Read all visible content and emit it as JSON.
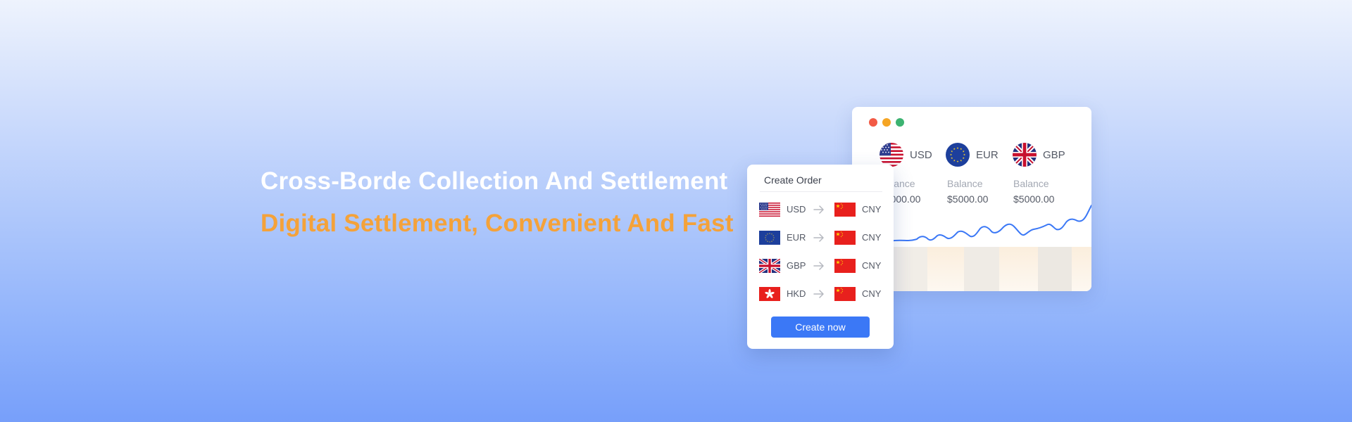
{
  "hero": {
    "headline": "Cross-Borde Collection And Settlement",
    "subheadline": "Digital Settlement, Convenient And Fast"
  },
  "colors": {
    "accent_orange": "#f4a23a",
    "primary_blue": "#3b78f6",
    "dot_red": "#f25a45",
    "dot_yellow": "#f5a524",
    "dot_green": "#3cb371"
  },
  "dashboard": {
    "window_controls": [
      "close",
      "minimize",
      "maximize"
    ],
    "currencies": [
      {
        "code": "USD",
        "icon": "us-flag-icon"
      },
      {
        "code": "EUR",
        "icon": "eu-flag-icon"
      },
      {
        "code": "GBP",
        "icon": "uk-flag-icon"
      }
    ],
    "balances": [
      {
        "label": "Balance",
        "value": "$5000.00"
      },
      {
        "label": "Balance",
        "value": "$5000.00"
      },
      {
        "label": "Balance",
        "value": "$5000.00"
      }
    ]
  },
  "order": {
    "title": "Create Order",
    "rows": [
      {
        "from": "USD",
        "from_icon": "us-flag-icon",
        "to": "CNY",
        "to_icon": "cn-flag-icon"
      },
      {
        "from": "EUR",
        "from_icon": "eu-flag-icon",
        "to": "CNY",
        "to_icon": "cn-flag-icon"
      },
      {
        "from": "GBP",
        "from_icon": "uk-flag-icon",
        "to": "CNY",
        "to_icon": "cn-flag-icon"
      },
      {
        "from": "HKD",
        "from_icon": "hk-flag-icon",
        "to": "CNY",
        "to_icon": "cn-flag-icon"
      }
    ],
    "button_label": "Create now"
  }
}
